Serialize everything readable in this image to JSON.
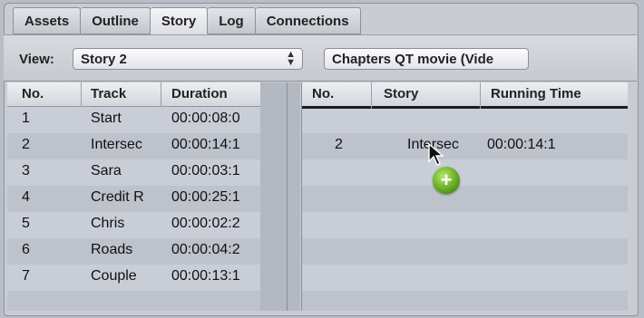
{
  "tabs": [
    "Assets",
    "Outline",
    "Story",
    "Log",
    "Connections"
  ],
  "active_tab": "Story",
  "view": {
    "label": "View:",
    "selected": "Story 2",
    "chapters_button": "Chapters QT movie (Vide"
  },
  "left_table": {
    "headers": [
      "No.",
      "Track",
      "Duration"
    ],
    "rows": [
      [
        "1",
        "Start",
        "00:00:08:0"
      ],
      [
        "2",
        "Intersec",
        "00:00:14:1"
      ],
      [
        "3",
        "Sara",
        "00:00:03:1"
      ],
      [
        "4",
        "Credit R",
        "00:00:25:1"
      ],
      [
        "5",
        "Chris",
        "00:00:02:2"
      ],
      [
        "6",
        "Roads",
        "00:00:04:2"
      ],
      [
        "7",
        "Couple",
        "00:00:13:1"
      ]
    ]
  },
  "right_table": {
    "headers": [
      "No.",
      "Story",
      "Running Time"
    ],
    "rows": [
      [
        "2",
        "Intersec",
        "00:00:14:1"
      ]
    ]
  }
}
